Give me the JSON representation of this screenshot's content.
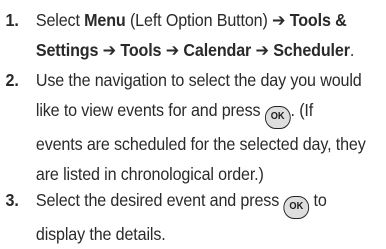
{
  "steps": [
    {
      "number": "1.",
      "parts": {
        "select": "Select ",
        "menu": "Menu",
        "menu_hint": " (Left Option Button) ",
        "arrow1": "➔",
        "tools_settings": " Tools &",
        "line2_settings": "Settings ",
        "arrow2": "➔",
        "tools": " Tools ",
        "arrow3": "➔",
        "calendar": " Calendar ",
        "arrow4": "➔",
        "scheduler": " Scheduler",
        "end": "."
      }
    },
    {
      "number": "2.",
      "line1": "Use the navigation to select the day you would",
      "line2_before": "like to view events for and press ",
      "line2_after": ". (If",
      "line3": "events are scheduled for the selected day, they",
      "line4": "are listed in chronological order.)"
    },
    {
      "number": "3.",
      "line1_before": "Select the desired event and press ",
      "line1_after": " to",
      "line2": "display the details."
    }
  ],
  "ok_button_label": "OK",
  "ok_button_icon": "ok-button-icon"
}
